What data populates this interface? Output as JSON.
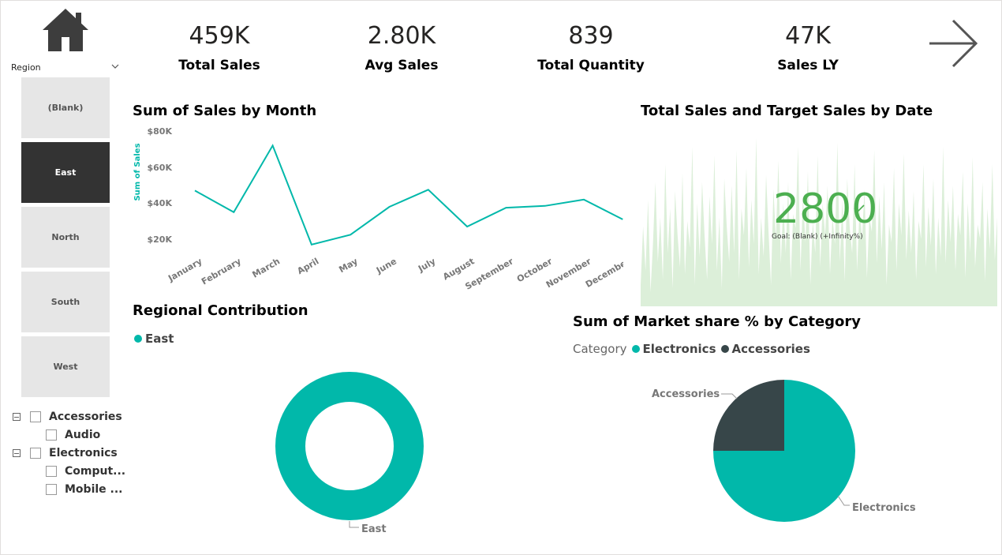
{
  "colors": {
    "teal": "#01b8aa",
    "dark": "#374649",
    "area": "#dcefd9",
    "green": "#4caf50"
  },
  "nav": {
    "home_icon": "home-icon",
    "next_icon": "arrow-right-icon"
  },
  "kpis": [
    {
      "value": "459K",
      "label": "Total Sales"
    },
    {
      "value": "2.80K",
      "label": "Avg Sales"
    },
    {
      "value": "839",
      "label": "Total Quantity"
    },
    {
      "value": "47K",
      "label": "Sales LY"
    }
  ],
  "region_slicer": {
    "title": "Region",
    "items": [
      "(Blank)",
      "East",
      "North",
      "South",
      "West"
    ],
    "selected": "East"
  },
  "category_tree": [
    {
      "label": "Accessories",
      "level": 0
    },
    {
      "label": "Audio",
      "level": 1
    },
    {
      "label": "Electronics",
      "level": 0
    },
    {
      "label": "Comput...",
      "level": 1
    },
    {
      "label": "Mobile ...",
      "level": 1
    }
  ],
  "line_chart": {
    "title": "Sum of Sales by Month",
    "ylabel": "Sum of Sales",
    "yticks": [
      "$20K",
      "$40K",
      "$60K",
      "$80K"
    ]
  },
  "gauge_chart": {
    "title": "Total Sales and Target Sales by Date",
    "value": "2800",
    "goal_text": "Goal: (Blank) (+Infinity%)"
  },
  "donut_chart": {
    "title": "Regional Contribution",
    "legend": "East",
    "slice_label": "East"
  },
  "pie_chart": {
    "title": "Sum of Market share % by Category",
    "legend_title": "Category",
    "legend_items": [
      "Electronics",
      "Accessories"
    ],
    "labels": [
      "Accessories",
      "Electronics"
    ]
  },
  "chart_data": [
    {
      "type": "line",
      "title": "Sum of Sales by Month",
      "ylabel": "Sum of Sales",
      "categories": [
        "January",
        "February",
        "March",
        "April",
        "May",
        "June",
        "July",
        "August",
        "September",
        "October",
        "November",
        "December"
      ],
      "values": [
        47000,
        35000,
        72000,
        17000,
        22500,
        38000,
        47500,
        27000,
        37500,
        38500,
        42000,
        31000
      ],
      "ylim": [
        10000,
        85000
      ]
    },
    {
      "type": "area",
      "title": "Total Sales and Target Sales by Date",
      "values": [
        12,
        45,
        20,
        60,
        8,
        35,
        70,
        25,
        50,
        15,
        80,
        30,
        55,
        10,
        65,
        40,
        22,
        75,
        18,
        48,
        33,
        90,
        12,
        58,
        28,
        70,
        40,
        15,
        62,
        35,
        85,
        20,
        50,
        10,
        72,
        45,
        25,
        68,
        30,
        88,
        15,
        55,
        40,
        78,
        22,
        60,
        35,
        95,
        18,
        50,
        28,
        74,
        42,
        12,
        66,
        38,
        82,
        24,
        58,
        30,
        70,
        15,
        52,
        44,
        90,
        20,
        62,
        36,
        76,
        12,
        48,
        30,
        85,
        22,
        58,
        40,
        68,
        18,
        50,
        35,
        92,
        25,
        60,
        14,
        72,
        44,
        30,
        80,
        20,
        55,
        38,
        66,
        16,
        50,
        42,
        88,
        24,
        62,
        32,
        70,
        12,
        46,
        36,
        78,
        20,
        58,
        40,
        86,
        26,
        54,
        30,
        65,
        15,
        48,
        38,
        80,
        22,
        56,
        34,
        72,
        18,
        50,
        28,
        90,
        24,
        60,
        36,
        68,
        20,
        52,
        40,
        76,
        16,
        58,
        30,
        84,
        22,
        46,
        38,
        70,
        14,
        55,
        32,
        80,
        26,
        50
      ]
    },
    {
      "type": "pie",
      "title": "Regional Contribution",
      "categories": [
        "East"
      ],
      "values": [
        100
      ]
    },
    {
      "type": "pie",
      "title": "Sum of Market share % by Category",
      "categories": [
        "Electronics",
        "Accessories"
      ],
      "values": [
        75,
        25
      ]
    }
  ]
}
